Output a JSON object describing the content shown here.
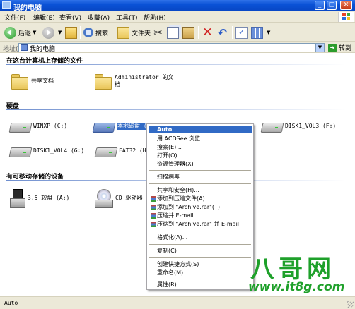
{
  "window": {
    "title": "我的电脑"
  },
  "menubar": [
    "文件(F)",
    "编辑(E)",
    "查看(V)",
    "收藏(A)",
    "工具(T)",
    "帮助(H)"
  ],
  "toolbar": {
    "back": "后退",
    "search": "搜索",
    "folders": "文件夹"
  },
  "address": {
    "label": "地址(D)",
    "value": "我的电脑",
    "go": "转到"
  },
  "groups": {
    "stored": "在这台计算机上存储的文件",
    "hdd": "硬盘",
    "removable": "有可移动存储的设备"
  },
  "items": {
    "shared_docs": "共享文档",
    "admin_docs_1": "Administrator 的文",
    "admin_docs_2": "档",
    "winxp": "WINXP (C:)",
    "local_disk": "本地磁盘 (D:)",
    "disk1_vol3": "DISK1_VOL3 (F:)",
    "disk1_vol4": "DISK1_VOL4 (G:)",
    "fat32": "FAT32 (H:)",
    "floppy": "3.5 软盘 (A:)",
    "cd": "CD 驱动器"
  },
  "context_menu": {
    "auto": "Auto",
    "acdsee": "用 ACDSee 浏览",
    "search": "搜索(E)...",
    "open": "打开(O)",
    "explorer": "资源管理器(X)",
    "scan": "扫描病毒...",
    "sharing": "共享和安全(H)...",
    "add_archive": "添加到压缩文件(A)...",
    "add_rar": "添加到 \"Archive.rar\"(T)",
    "zip_email": "压缩并 E-mail...",
    "zip_rar_email": "压缩到 \"Archive.rar\" 并 E-mail",
    "format": "格式化(A)...",
    "copy": "复制(C)",
    "shortcut": "创建快捷方式(S)",
    "rename": "重命名(M)",
    "properties": "属性(R)"
  },
  "watermark": {
    "logo": "八哥网",
    "url": "www.it8g.com"
  },
  "status": {
    "text": "Auto"
  }
}
